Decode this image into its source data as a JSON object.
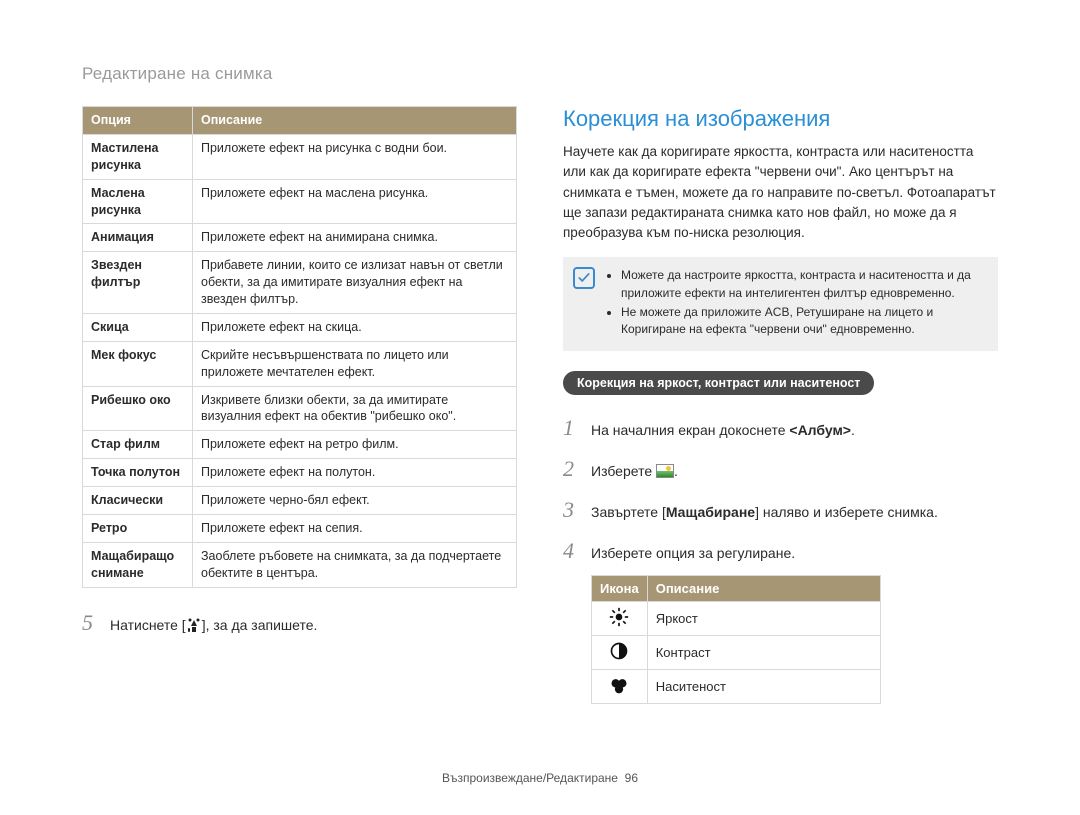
{
  "page_title": "Редактиране на снимка",
  "option_table": {
    "headers": {
      "option": "Опция",
      "description": "Описание"
    },
    "rows": [
      {
        "name": "Мастилена рисунка",
        "desc": "Приложете ефект на рисунка с водни бои."
      },
      {
        "name": "Маслена рисунка",
        "desc": "Приложете ефект на маслена рисунка."
      },
      {
        "name": "Анимация",
        "desc": "Приложете ефект на анимирана снимка."
      },
      {
        "name": "Звезден филтър",
        "desc": "Прибавете линии, които се излизат навън от светли обекти, за да имитирате визуалния ефект на звезден филтър."
      },
      {
        "name": "Скица",
        "desc": "Приложете ефект на скица."
      },
      {
        "name": "Мек фокус",
        "desc": "Скрийте несъвършенствата по лицето или приложете мечтателен ефект."
      },
      {
        "name": "Рибешко око",
        "desc": "Изкривете близки обекти, за да имитирате визуалния ефект на обектив \"рибешко око\"."
      },
      {
        "name": "Стар филм",
        "desc": "Приложете ефект на ретро филм."
      },
      {
        "name": "Точка полутон",
        "desc": "Приложете ефект на полутон."
      },
      {
        "name": "Класически",
        "desc": "Приложете черно-бял ефект."
      },
      {
        "name": "Ретро",
        "desc": "Приложете ефект на сепия."
      },
      {
        "name": "Мащабиращо снимане",
        "desc": "Заоблете ръбовете на снимката, за да подчертаете обектите в центъра."
      }
    ]
  },
  "left_step_5": {
    "num": "5",
    "text_before": "Натиснете [",
    "text_after": "], за да запишете."
  },
  "right_heading": "Корекция на изображения",
  "right_paragraph": "Научете как да коригирате яркостта, контраста или наситеността или как да коригирате ефекта \"червени очи\". Ако центърът на снимката е тъмен, можете да го направите по-светъл. Фотоапаратът ще запази редактираната снимка като нов файл, но може да я преобразува към по-ниска резолюция.",
  "note": {
    "bullets": [
      "Можете да настроите яркостта, контраста и наситеността и да приложите ефекти на интелигентен филтър едновременно.",
      "Не можете да приложите ACB, Ретуширане на лицето и Коригиране на ефекта \"червени очи\" едновременно."
    ]
  },
  "pill": "Корекция на яркост, контраст или наситеност",
  "steps": [
    {
      "num": "1",
      "text_before": "На началния екран докоснете ",
      "bold": "<Албум>",
      "text_after": "."
    },
    {
      "num": "2",
      "text_before": "Изберете ",
      "text_after": "."
    },
    {
      "num": "3",
      "text_before": "Завъртете [",
      "bold": "Мащабиране",
      "text_after": "] наляво и изберете снимка."
    },
    {
      "num": "4",
      "text_before": "Изберете опция за регулиране.",
      "text_after": ""
    }
  ],
  "icon_table": {
    "headers": {
      "icon": "Икона",
      "description": "Описание"
    },
    "rows": [
      {
        "icon": "brightness-icon",
        "label": "Яркост"
      },
      {
        "icon": "contrast-icon",
        "label": "Контраст"
      },
      {
        "icon": "saturation-icon",
        "label": "Наситеност"
      }
    ]
  },
  "footer": {
    "section": "Възпроизвеждане/Редактиране",
    "page": "96"
  }
}
